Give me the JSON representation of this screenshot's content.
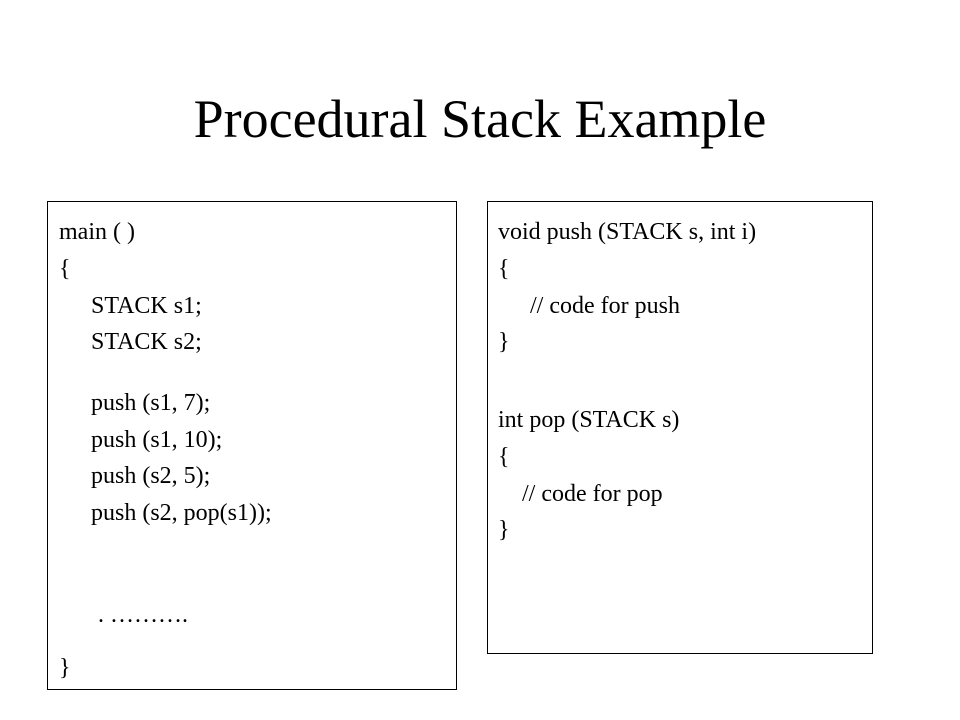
{
  "title": "Procedural Stack Example",
  "main_code": {
    "header": "main ( )",
    "open_brace": "{",
    "decl1": "STACK s1;",
    "decl2": "STACK s2;",
    "call1": "push (s1, 7);",
    "call2": "push (s1, 10);",
    "call3": "push (s2, 5);",
    "call4": "push (s2, pop(s1));",
    "ellipsis": ". ……….",
    "close_brace": "}"
  },
  "functions_code": {
    "push_signature": "void push (STACK s, int i)",
    "push_open": "{",
    "push_comment": "// code for push",
    "push_close": "}",
    "pop_signature": "int pop (STACK s)",
    "pop_open": "{",
    "pop_comment": "// code for pop",
    "pop_close": "}"
  }
}
